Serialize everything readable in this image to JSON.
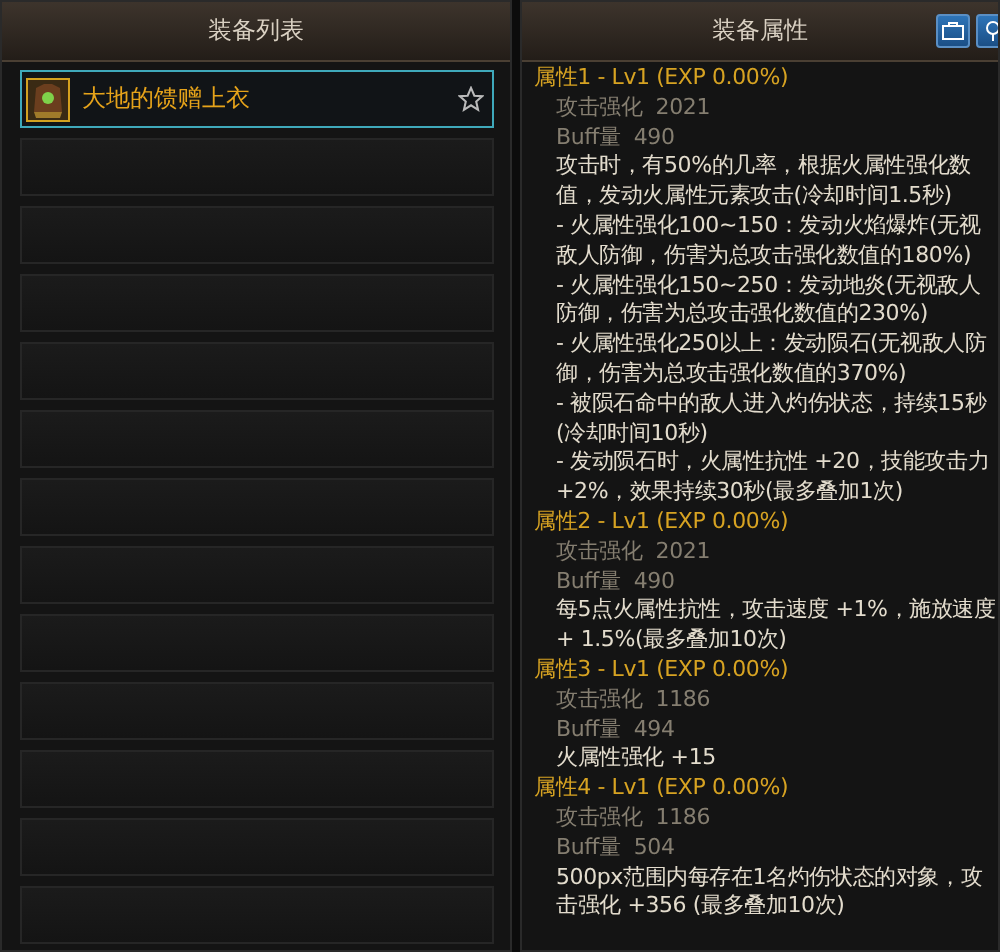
{
  "list_panel": {
    "title": "装备列表",
    "items": [
      {
        "kind": "item",
        "name": "大地的馈赠上衣",
        "selected": true
      },
      {
        "kind": "empty",
        "selected": false
      },
      {
        "kind": "empty",
        "selected": false
      },
      {
        "kind": "empty",
        "selected": false
      },
      {
        "kind": "empty",
        "selected": false
      },
      {
        "kind": "empty",
        "selected": false
      },
      {
        "kind": "empty",
        "selected": false
      },
      {
        "kind": "empty",
        "selected": false
      },
      {
        "kind": "empty",
        "selected": false
      },
      {
        "kind": "empty",
        "selected": false
      },
      {
        "kind": "empty",
        "selected": false
      },
      {
        "kind": "empty",
        "selected": false
      },
      {
        "kind": "empty",
        "selected": false
      }
    ]
  },
  "detail_panel": {
    "title": "装备属性",
    "attributes": [
      {
        "title": "属性1 - Lv1 (EXP 0.00%)",
        "stats": [
          {
            "label": "攻击强化",
            "value": "2021"
          },
          {
            "label": "Buff量",
            "value": "490"
          }
        ],
        "effects": [
          "攻击时，有50%的几率，根据火属性强化数值，发动火属性元素攻击(冷却时间1.5秒)",
          "- 火属性强化100~150：发动火焰爆炸(无视敌人防御，伤害为总攻击强化数值的180%)",
          "- 火属性强化150~250：发动地炎(无视敌人防御，伤害为总攻击强化数值的230%)",
          "- 火属性强化250以上：发动陨石(无视敌人防御，伤害为总攻击强化数值的370%)",
          "- 被陨石命中的敌人进入灼伤状态，持续15秒(冷却时间10秒)",
          "- 发动陨石时，火属性抗性 +20，技能攻击力 +2%，效果持续30秒(最多叠加1次)"
        ]
      },
      {
        "title": "属性2 - Lv1 (EXP 0.00%)",
        "stats": [
          {
            "label": "攻击强化",
            "value": "2021"
          },
          {
            "label": "Buff量",
            "value": "490"
          }
        ],
        "effects": [
          "每5点火属性抗性，攻击速度 +1%，施放速度+ 1.5%(最多叠加10次)"
        ]
      },
      {
        "title": "属性3 - Lv1 (EXP 0.00%)",
        "stats": [
          {
            "label": "攻击强化",
            "value": "1186"
          },
          {
            "label": "Buff量",
            "value": "494"
          }
        ],
        "effects": [
          "火属性强化 +15"
        ]
      },
      {
        "title": "属性4 - Lv1 (EXP 0.00%)",
        "stats": [
          {
            "label": "攻击强化",
            "value": "1186"
          },
          {
            "label": "Buff量",
            "value": "504"
          }
        ],
        "effects": [
          "500px范围内每存在1名灼伤状态的对象，攻击强化 +356 (最多叠加10次)"
        ]
      }
    ]
  }
}
